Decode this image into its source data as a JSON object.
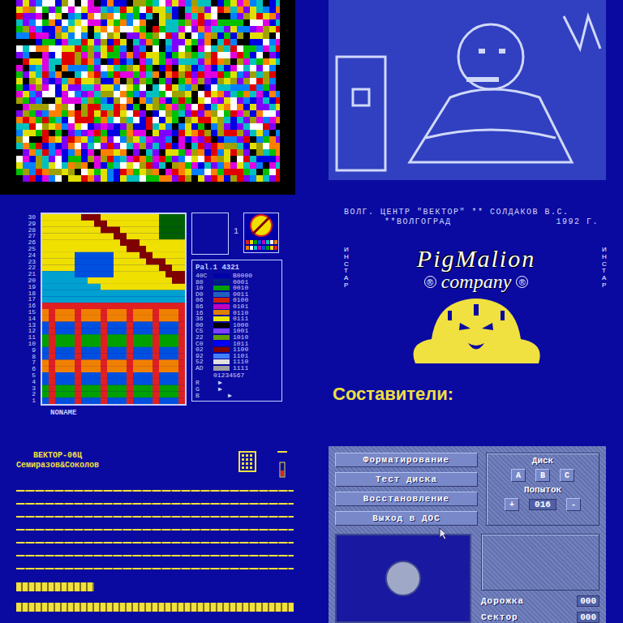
{
  "palette_editor": {
    "row_numbers": [
      "30",
      "29",
      "28",
      "27",
      "26",
      "25",
      "24",
      "23",
      "22",
      "21",
      "20",
      "19",
      "18",
      "17",
      "16",
      "15",
      "14",
      "13",
      "12",
      "11",
      "10",
      "9",
      "8",
      "7",
      "6",
      "5",
      "4",
      "3",
      "2",
      "1"
    ],
    "preview_number": "1",
    "palette_title": "Pal.1 4321",
    "palette": [
      {
        "code": "40C",
        "bits": "B0000",
        "color": "#0000a8"
      },
      {
        "code": "80",
        "bits": "0001",
        "color": "#002080"
      },
      {
        "code": "10",
        "bits": "0010",
        "color": "#00a000"
      },
      {
        "code": "D0",
        "bits": "0011",
        "color": "#2060c0"
      },
      {
        "code": "06",
        "bits": "0100",
        "color": "#d02000"
      },
      {
        "code": "86",
        "bits": "0101",
        "color": "#c000c0"
      },
      {
        "code": "16",
        "bits": "0110",
        "color": "#e08000"
      },
      {
        "code": "36",
        "bits": "0111",
        "color": "#e8e800"
      },
      {
        "code": "00",
        "bits": "1000",
        "color": "#000000"
      },
      {
        "code": "C5",
        "bits": "1001",
        "color": "#8040ff"
      },
      {
        "code": "22",
        "bits": "1010",
        "color": "#60a000"
      },
      {
        "code": "C0",
        "bits": "1011",
        "color": "#0000ff"
      },
      {
        "code": "02",
        "bits": "1100",
        "color": "#800000"
      },
      {
        "code": "92",
        "bits": "1101",
        "color": "#4080ff"
      },
      {
        "code": "52",
        "bits": "1110",
        "color": "#e0e0e0"
      },
      {
        "code": "AD",
        "bits": "1111",
        "color": "#a0a0a0"
      }
    ],
    "columns": "01234567",
    "channels": [
      {
        "name": "R",
        "marker": "▶",
        "level": 0.1
      },
      {
        "name": "G",
        "marker": "▶",
        "level": 0.1
      },
      {
        "name": "B",
        "marker": "▶",
        "level": 0.3
      }
    ],
    "filename": "NONAME"
  },
  "title_screen": {
    "header": "ВОЛГ. ЦЕНТР \"ВЕКТОР\" ** СОЛДАКОВ В.С.",
    "city": "**ВОЛГОГРАД",
    "year": "1992 Г.",
    "side_label": "ИНСТАР",
    "logo": {
      "name": "PigMalion",
      "subtitle": "company",
      "mark": "®"
    },
    "credits_heading": "Составители:"
  },
  "vector_screen": {
    "title": "ВЕКТОР-06Ц",
    "authors": "Семиразов&Соколов",
    "bars": [
      {
        "level": 0.28
      },
      {
        "level": 1
      }
    ]
  },
  "disk_utility": {
    "menu": [
      {
        "label": "Форматирование"
      },
      {
        "label": "Тест диска"
      },
      {
        "label": "Восстановление"
      },
      {
        "label": "Выход в ДОС"
      }
    ],
    "disk": {
      "title": "Диск",
      "options": [
        {
          "label": "A",
          "selected": false
        },
        {
          "label": "B",
          "selected": false
        },
        {
          "label": "C",
          "selected": false
        }
      ]
    },
    "retries": {
      "title": "Попыток",
      "increment": "+",
      "value": "016",
      "decrement": "-"
    },
    "readouts": [
      {
        "label": "Дорожка",
        "value": "000"
      },
      {
        "label": "Сектор",
        "value": "000"
      }
    ]
  }
}
